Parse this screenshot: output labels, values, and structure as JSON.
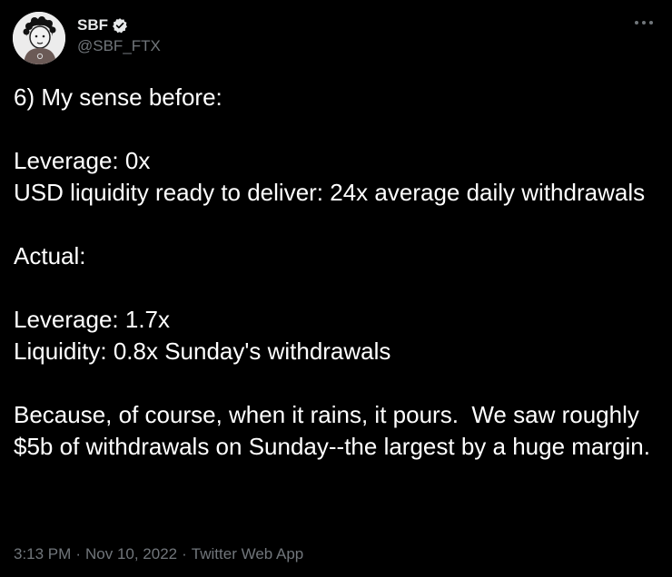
{
  "author": {
    "display_name": "SBF",
    "handle": "@SBF_FTX",
    "avatar_icon": "avatar-icon",
    "verified_icon": "verified-badge-icon"
  },
  "menu": {
    "icon": "more-options-icon"
  },
  "tweet": {
    "paragraphs": [
      "6) My sense before:",
      "Leverage: 0x\nUSD liquidity ready to deliver: 24x average daily withdrawals",
      "Actual:",
      "Leverage: 1.7x\nLiquidity: 0.8x Sunday's withdrawals",
      "Because, of course, when it rains, it pours.  We saw roughly $5b of withdrawals on Sunday--the largest by a huge margin."
    ]
  },
  "meta": {
    "time": "3:13 PM",
    "separator": "·",
    "date": "Nov 10, 2022",
    "source": "Twitter Web App"
  },
  "colors": {
    "background": "#000000",
    "text": "#ffffff",
    "muted": "#71767b",
    "verified": "#e7e9ea"
  }
}
